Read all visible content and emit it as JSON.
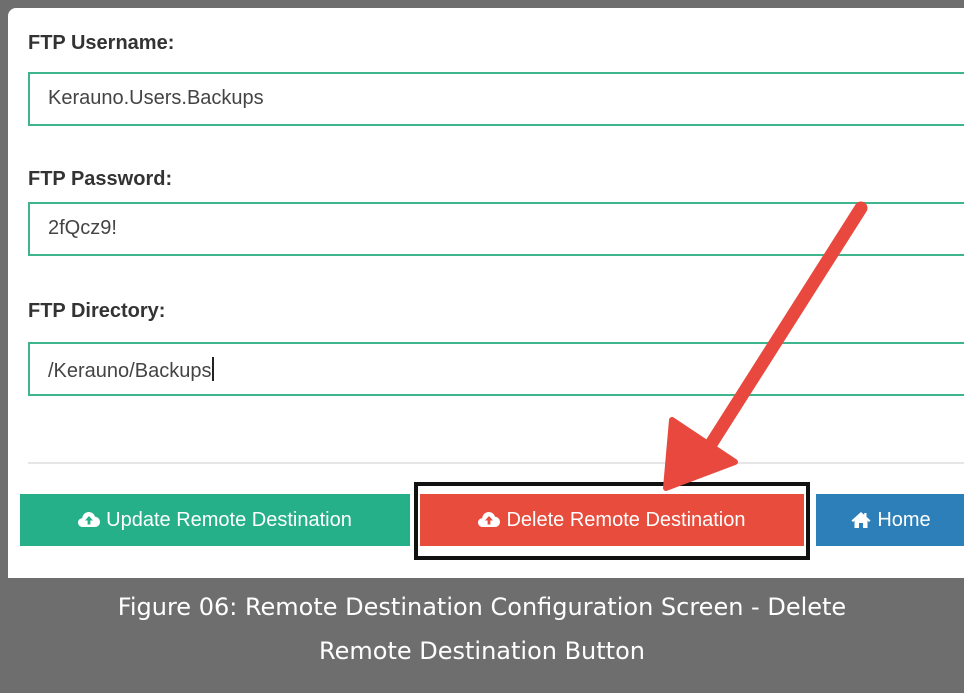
{
  "form": {
    "username_label": "FTP Username:",
    "username_value": "Kerauno.Users.Backups",
    "password_label": "FTP Password:",
    "password_value": "2fQcz9!",
    "directory_label": "FTP Directory:",
    "directory_value": "/Kerauno/Backups"
  },
  "buttons": {
    "update_label": "Update Remote Destination",
    "update_icon": "cloud-upload-icon",
    "delete_label": "Delete Remote Destination",
    "delete_icon": "cloud-upload-icon",
    "home_label": "Home",
    "home_icon": "home-icon"
  },
  "caption": {
    "line1": "Figure 06: Remote Destination Configuration Screen - Delete",
    "line2": "Remote Destination Button"
  },
  "colors": {
    "update": "#26b08a",
    "delete": "#e74c3c",
    "home": "#2c7fb8",
    "field_border": "#3fb58e",
    "annotation_arrow": "#e8483d"
  }
}
